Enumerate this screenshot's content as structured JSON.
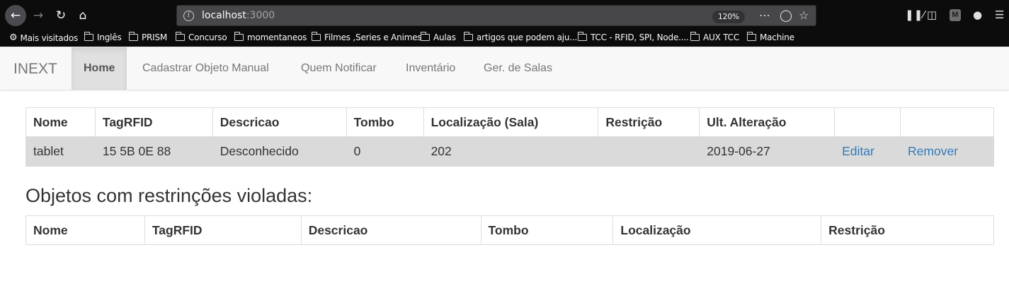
{
  "browser": {
    "url_host": "localhost",
    "url_port": ":3000",
    "zoom": "120%",
    "bookmarks": [
      "Mais visitados",
      "Inglês",
      "PRISM",
      "Concurso",
      "momentaneos",
      "Filmes ,Series e Animes",
      "Aulas",
      "artigos que podem aju...",
      "TCC - RFID, SPI, Node....",
      "AUX TCC",
      "Machine"
    ],
    "extension_label": "M"
  },
  "navbar": {
    "brand": "INEXT",
    "links": [
      "Home",
      "Cadastrar Objeto Manual",
      "Quem Notificar",
      "Inventário",
      "Ger. de Salas"
    ]
  },
  "objects_table": {
    "headers": [
      "Nome",
      "TagRFID",
      "Descricao",
      "Tombo",
      "Localização (Sala)",
      "Restrição",
      "Ult. Alteração",
      "",
      ""
    ],
    "rows": [
      {
        "nome": "tablet",
        "tag": "15 5B 0E 88",
        "descricao": "Desconhecido",
        "tombo": "0",
        "localizacao": "202",
        "restricao": "",
        "ult_alteracao": "2019-06-27",
        "edit_label": "Editar",
        "remove_label": "Remover"
      }
    ]
  },
  "violations": {
    "title": "Objetos com restrinções violadas:",
    "headers": [
      "Nome",
      "TagRFID",
      "Descricao",
      "Tombo",
      "Localização",
      "Restrição"
    ]
  },
  "colors": {
    "chrome_bg": "#0c0c0d",
    "navbar_bg": "#f8f8f8",
    "active_nav_bg": "#e0e0e0",
    "link": "#337ab7",
    "row_highlight": "#dadada"
  }
}
